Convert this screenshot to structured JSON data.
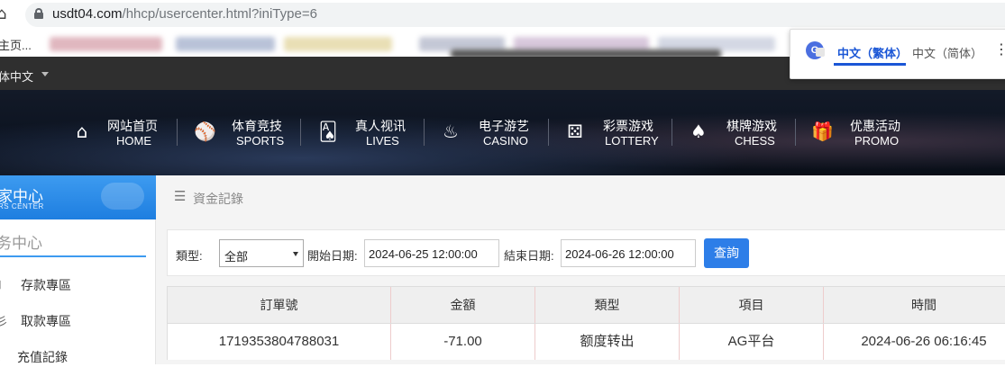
{
  "browser": {
    "url_host": "usdt04.com",
    "url_path": "/hhcp/usercenter.html?iniType=6",
    "bookmark_first": "主页..."
  },
  "translate_popup": {
    "option_active": "中文（繁体）",
    "option_other": "中文（简体）",
    "more": "⋮",
    "logo": "G"
  },
  "topbar": {
    "language": "体中文"
  },
  "nav": [
    {
      "cn": "网站首页",
      "en": "HOME",
      "icon": "home-icon"
    },
    {
      "cn": "体育竞技",
      "en": "SPORTS",
      "icon": "ball-icon"
    },
    {
      "cn": "真人视讯",
      "en": "LIVES",
      "icon": "cards-icon"
    },
    {
      "cn": "电子游艺",
      "en": "CASINO",
      "icon": "slot-icon"
    },
    {
      "cn": "彩票游戏",
      "en": "LOTTERY",
      "icon": "dice-icon"
    },
    {
      "cn": "棋牌游戏",
      "en": "CHESS",
      "icon": "spade-icon"
    },
    {
      "cn": "优惠活动",
      "en": "PROMO",
      "icon": "gift-icon"
    }
  ],
  "sidebar": {
    "title": "家中心",
    "subtitle": "RS CENTER",
    "section": "务中心",
    "items": [
      {
        "label": "存款專區",
        "icon": "deposit-icon"
      },
      {
        "label": "取款專區",
        "icon": "withdraw-icon"
      },
      {
        "label": "充值記錄",
        "icon": "record-icon"
      }
    ]
  },
  "main": {
    "title": "資金記錄",
    "filter": {
      "type_label": "類型:",
      "type_value": "全部",
      "start_label": "開始日期:",
      "start_value": "2024-06-25 12:00:00",
      "end_label": "結束日期:",
      "end_value": "2024-06-26 12:00:00",
      "query_button": "查詢"
    },
    "table": {
      "headers": [
        "訂單號",
        "金額",
        "類型",
        "項目",
        "時間"
      ],
      "rows": [
        [
          "1719353804788031",
          "-71.00",
          "额度转出",
          "AG平台",
          "2024-06-26 06:16:45"
        ]
      ]
    }
  },
  "colors": {
    "accent_blue": "#2d7ee8",
    "sidebar_blue": "#1e7ee0",
    "topbar_dark": "#2f2f2f"
  }
}
